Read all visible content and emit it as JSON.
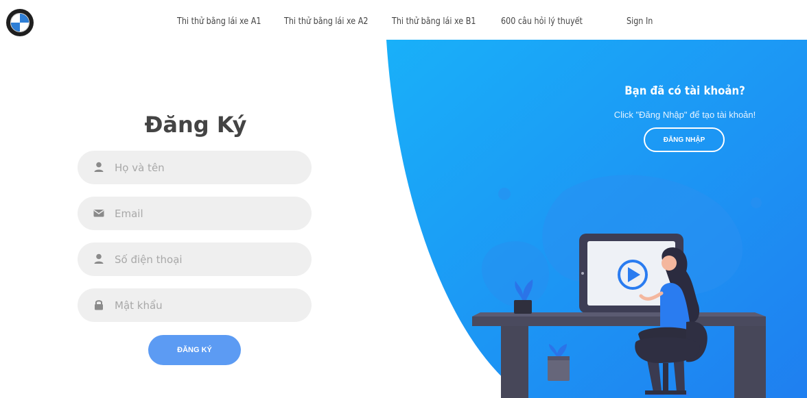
{
  "nav": {
    "links": [
      "Thi thử bằng lái xe A1",
      "Thi thử bằng lái xe A2",
      "Thi thử bằng lái xe B1",
      "600 câu hỏi lý thuyết",
      "Sign In"
    ]
  },
  "signup": {
    "title": "Đăng Ký",
    "fields": {
      "name_placeholder": "Họ và tên",
      "email_placeholder": "Email",
      "phone_placeholder": "Số điện thoại",
      "password_placeholder": "Mật khẩu"
    },
    "submit_label": "ĐĂNG KÝ"
  },
  "login_panel": {
    "title": "Bạn đã có tài khoản?",
    "subtitle": "Click \"Đăng Nhập\" để tạo tài khoản!",
    "button_label": "ĐĂNG NHẬP"
  },
  "icons": {
    "brand": "bmw-logo-icon",
    "name": "user-icon",
    "email": "envelope-icon",
    "phone": "user-icon",
    "password": "lock-icon"
  },
  "colors": {
    "panel_blue_light": "#1aaaf8",
    "panel_blue_dark": "#1f86ee",
    "submit_blue": "#5c9bf3",
    "field_bg": "#efefef"
  }
}
